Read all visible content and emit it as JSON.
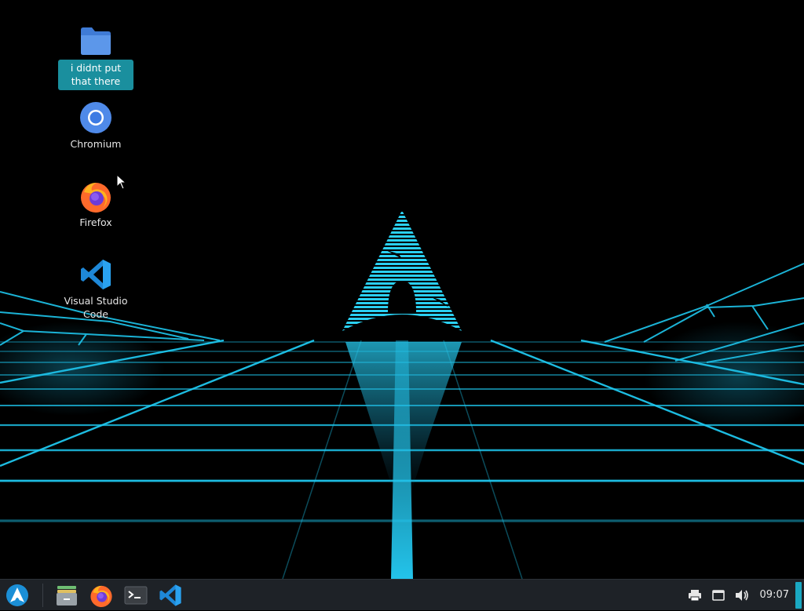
{
  "desktop": {
    "icons": [
      {
        "label": "i didnt put that there",
        "icon": "folder-icon",
        "selected": true
      },
      {
        "label": "Chromium",
        "icon": "chromium-icon",
        "selected": false
      },
      {
        "label": "Firefox",
        "icon": "firefox-icon",
        "selected": false
      },
      {
        "label": "Visual Studio Code",
        "icon": "vscode-icon",
        "selected": false
      }
    ],
    "wallpaper": "arch-logo-neon-grid"
  },
  "taskbar": {
    "launchers": [
      {
        "icon": "arch-start-menu-icon"
      },
      {
        "icon": "file-manager-icon"
      },
      {
        "icon": "firefox-icon"
      },
      {
        "icon": "terminal-icon"
      },
      {
        "icon": "vscode-icon"
      }
    ],
    "tray": [
      {
        "icon": "printer-icon"
      },
      {
        "icon": "window-icon"
      },
      {
        "icon": "volume-icon"
      }
    ],
    "clock": "09:07"
  },
  "colors": {
    "accent": "#1aa8c2",
    "selection": "#1a8f9e",
    "taskbar_bg": "#1e2227",
    "grid_cyan": "#1fd2f5"
  }
}
